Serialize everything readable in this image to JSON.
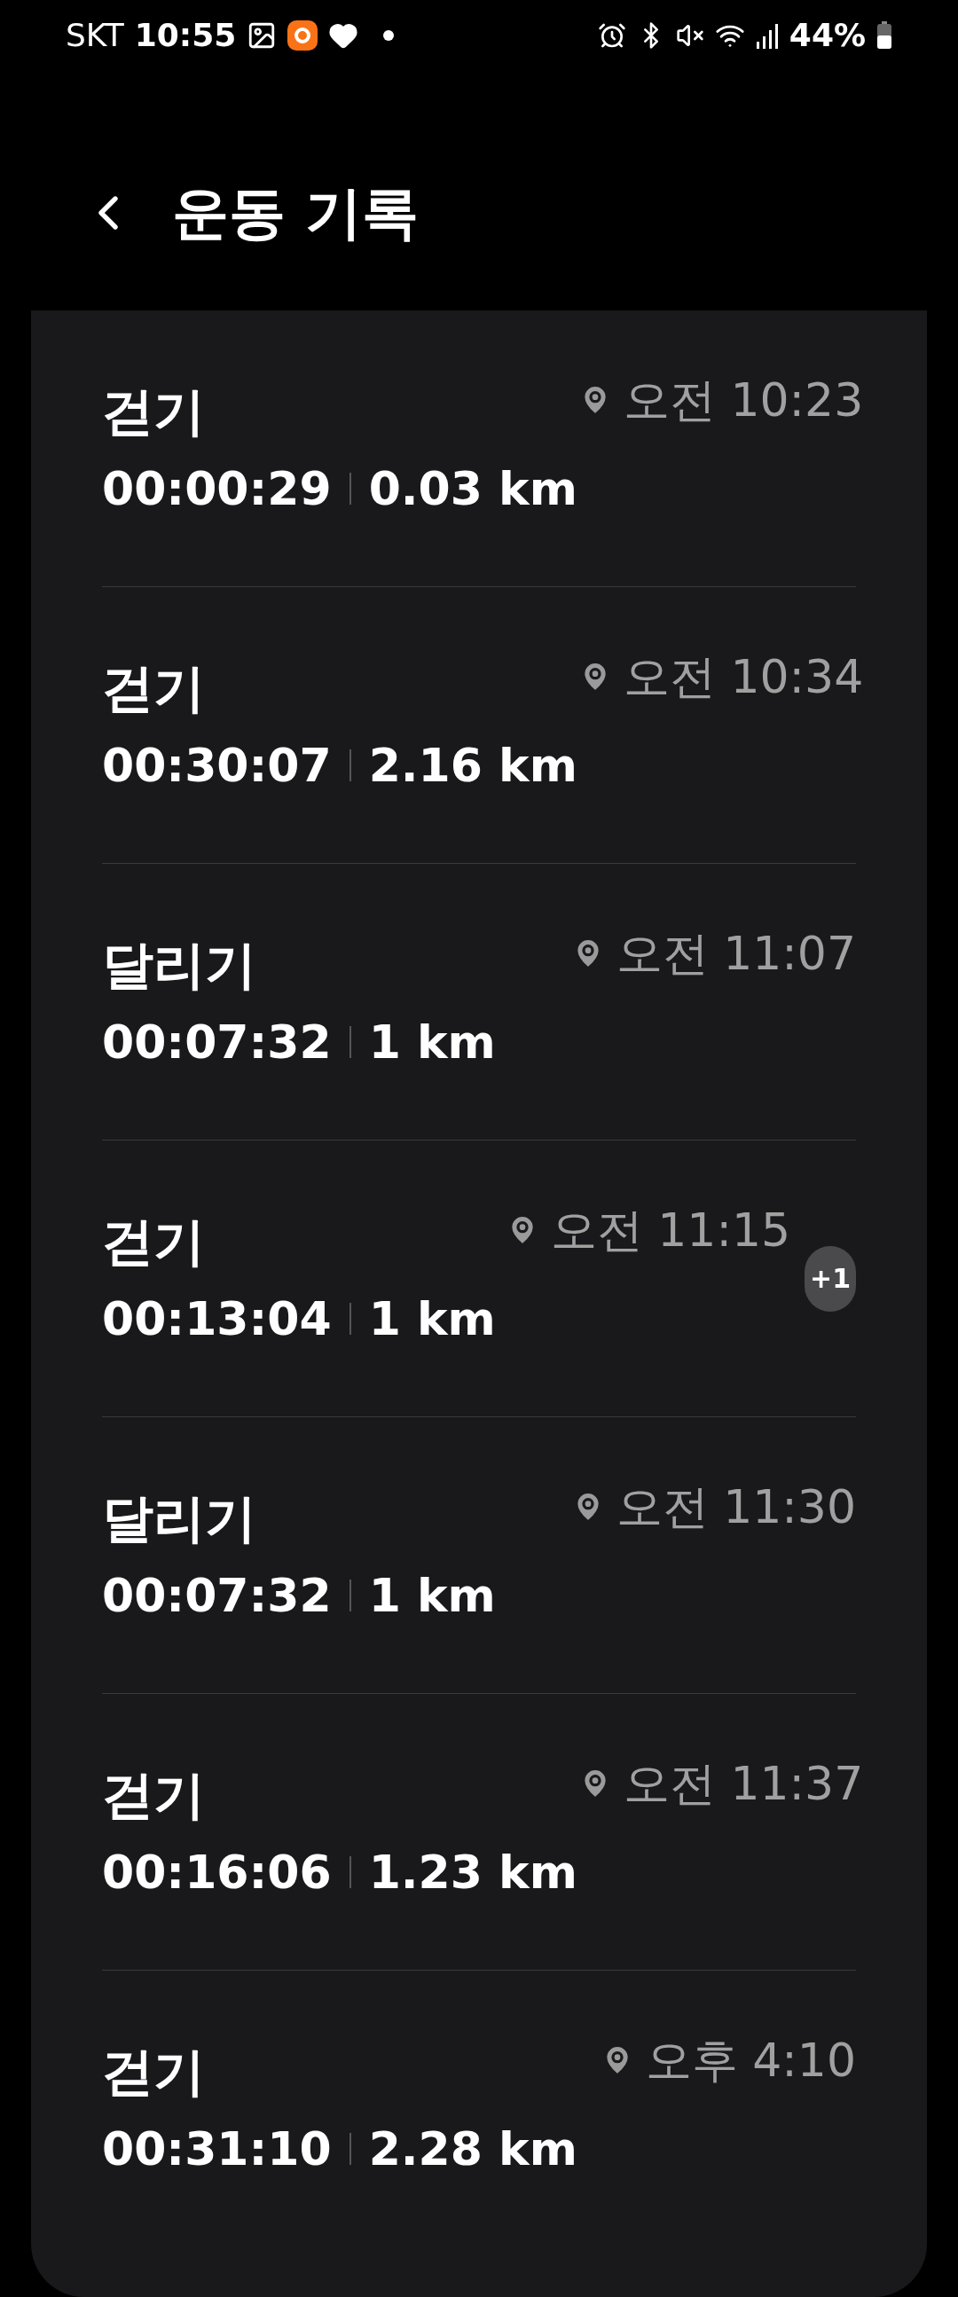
{
  "status_bar": {
    "carrier": "SKT",
    "time": "10:55",
    "battery": "44%"
  },
  "header": {
    "title": "운동 기록"
  },
  "records": [
    {
      "activity": "걷기",
      "time": "오전 10:23",
      "duration": "00:00:29",
      "distance": "0.03 km"
    },
    {
      "activity": "걷기",
      "time": "오전 10:34",
      "duration": "00:30:07",
      "distance": "2.16 km"
    },
    {
      "activity": "달리기",
      "time": "오전 11:07",
      "duration": "00:07:32",
      "distance": "1 km"
    },
    {
      "activity": "걷기",
      "time": "오전 11:15",
      "duration": "00:13:04",
      "distance": "1 km",
      "badge": "+1"
    },
    {
      "activity": "달리기",
      "time": "오전 11:30",
      "duration": "00:07:32",
      "distance": "1 km"
    },
    {
      "activity": "걷기",
      "time": "오전 11:37",
      "duration": "00:16:06",
      "distance": "1.23 km"
    },
    {
      "activity": "걷기",
      "time": "오후 4:10",
      "duration": "00:31:10",
      "distance": "2.28 km"
    }
  ]
}
